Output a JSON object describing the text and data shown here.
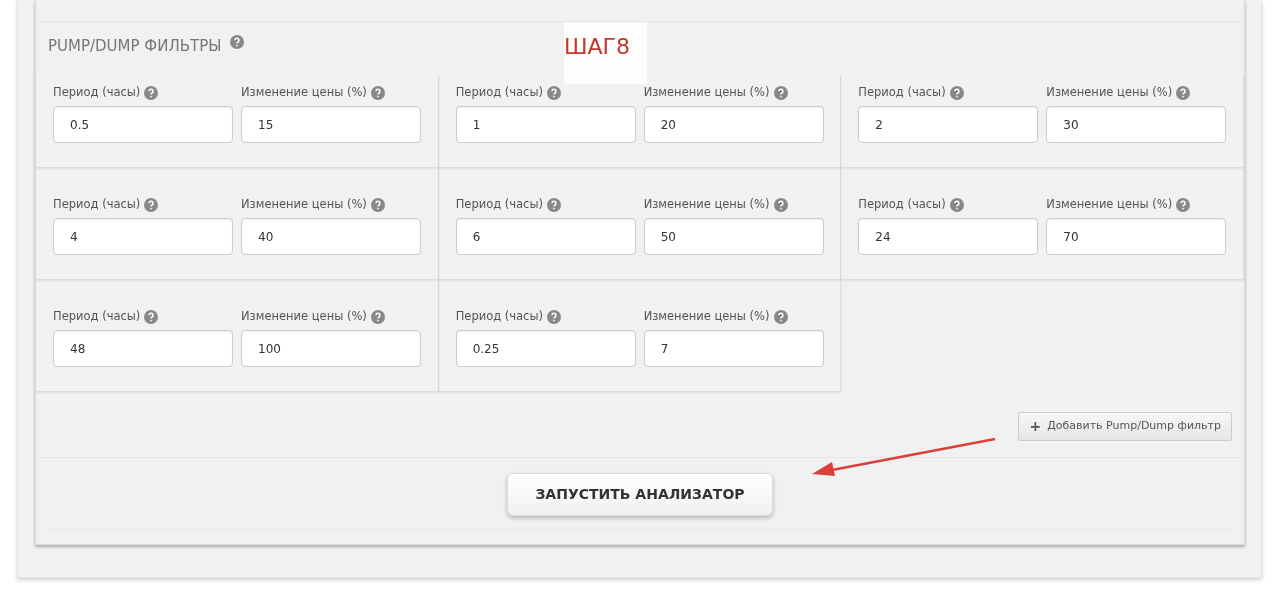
{
  "section": {
    "title": "PUMP/DUMP ФИЛЬТРЫ"
  },
  "annotation": {
    "text": "ШАГ8"
  },
  "filters": [
    {
      "period_label": "Период (часы)",
      "period_value": "0.5",
      "change_label": "Изменение цены (%)",
      "change_value": "15"
    },
    {
      "period_label": "Период (часы)",
      "period_value": "1",
      "change_label": "Изменение цены (%)",
      "change_value": "20"
    },
    {
      "period_label": "Период (часы)",
      "period_value": "2",
      "change_label": "Изменение цены (%)",
      "change_value": "30"
    },
    {
      "period_label": "Период (часы)",
      "period_value": "4",
      "change_label": "Изменение цены (%)",
      "change_value": "40"
    },
    {
      "period_label": "Период (часы)",
      "period_value": "6",
      "change_label": "Изменение цены (%)",
      "change_value": "50"
    },
    {
      "period_label": "Период (часы)",
      "period_value": "24",
      "change_label": "Изменение цены (%)",
      "change_value": "70"
    },
    {
      "period_label": "Период (часы)",
      "period_value": "48",
      "change_label": "Изменение цены (%)",
      "change_value": "100"
    },
    {
      "period_label": "Период (часы)",
      "period_value": "0.25",
      "change_label": "Изменение цены (%)",
      "change_value": "7"
    }
  ],
  "add_button": {
    "icon": "+",
    "label": "Добавить Pump/Dump фильтр"
  },
  "run_button": {
    "label": "ЗАПУСТИТЬ АНАЛИЗАТОР"
  }
}
